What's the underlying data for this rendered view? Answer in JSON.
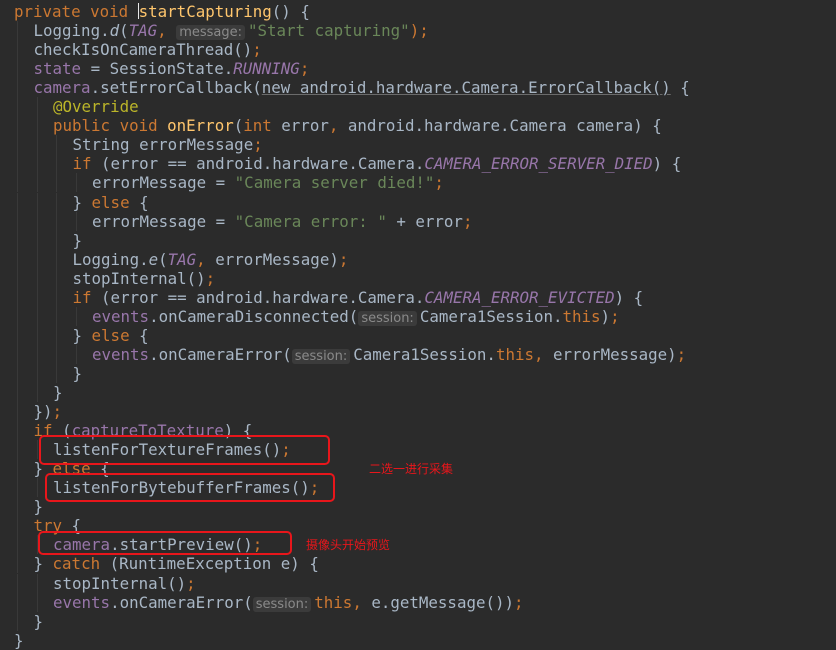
{
  "colors": {
    "background": "#2b2b2b",
    "keyword": "#cc7832",
    "plain": "#a9b7c6",
    "string": "#6a8759",
    "method_declaration": "#ffc66d",
    "field": "#9876aa",
    "annotation": "#bbb529",
    "annotation_box": "#e8161b",
    "annotation_text": "#e8161b"
  },
  "lines": [
    {
      "indent": 0,
      "tokens": [
        {
          "t": "private void ",
          "c": "kw"
        },
        {
          "t": "",
          "c": "caret"
        },
        {
          "t": "startCapturing",
          "c": "fn"
        },
        {
          "t": "() {",
          "c": "plain"
        }
      ]
    },
    {
      "indent": 1,
      "tokens": [
        {
          "t": "Logging.",
          "c": "plain"
        },
        {
          "t": "d",
          "c": "method-static"
        },
        {
          "t": "(",
          "c": "plain"
        },
        {
          "t": "TAG",
          "c": "static"
        },
        {
          "t": ", ",
          "c": "kw"
        },
        {
          "t": "message:",
          "c": "hint"
        },
        {
          "t": "\"Start capturing\"",
          "c": "str"
        },
        {
          "t": ");",
          "c": "kw"
        }
      ]
    },
    {
      "indent": 1,
      "tokens": [
        {
          "t": "checkIsOnCameraThread()",
          "c": "plain"
        },
        {
          "t": ";",
          "c": "kw"
        }
      ]
    },
    {
      "indent": 1,
      "tokens": [
        {
          "t": "state",
          "c": "field"
        },
        {
          "t": " = SessionState.",
          "c": "plain"
        },
        {
          "t": "RUNNING",
          "c": "static"
        },
        {
          "t": ";",
          "c": "kw"
        }
      ]
    },
    {
      "indent": 1,
      "tokens": [
        {
          "t": "camera",
          "c": "field"
        },
        {
          "t": ".setErrorCallback(",
          "c": "plain"
        },
        {
          "t": "new android.hardware.Camera.ErrorCallback()",
          "c": "anon"
        },
        {
          "t": " {",
          "c": "plain"
        }
      ]
    },
    {
      "indent": 2,
      "tokens": [
        {
          "t": "@Override",
          "c": "ann"
        }
      ]
    },
    {
      "indent": 2,
      "tokens": [
        {
          "t": "public void ",
          "c": "kw"
        },
        {
          "t": "onError",
          "c": "fn"
        },
        {
          "t": "(",
          "c": "plain"
        },
        {
          "t": "int ",
          "c": "kw"
        },
        {
          "t": "error",
          "c": "plain"
        },
        {
          "t": ", ",
          "c": "kw"
        },
        {
          "t": "android.hardware.Camera camera) {",
          "c": "plain"
        }
      ]
    },
    {
      "indent": 3,
      "tokens": [
        {
          "t": "String errorMessage",
          "c": "plain"
        },
        {
          "t": ";",
          "c": "kw"
        }
      ]
    },
    {
      "indent": 3,
      "tokens": [
        {
          "t": "if ",
          "c": "kw"
        },
        {
          "t": "(error == android.hardware.Camera.",
          "c": "plain"
        },
        {
          "t": "CAMERA_ERROR_SERVER_DIED",
          "c": "static"
        },
        {
          "t": ") {",
          "c": "plain"
        }
      ]
    },
    {
      "indent": 4,
      "tokens": [
        {
          "t": "errorMessage = ",
          "c": "plain"
        },
        {
          "t": "\"Camera server died!\"",
          "c": "str"
        },
        {
          "t": ";",
          "c": "kw"
        }
      ]
    },
    {
      "indent": 3,
      "tokens": [
        {
          "t": "} ",
          "c": "plain"
        },
        {
          "t": "else ",
          "c": "kw"
        },
        {
          "t": "{",
          "c": "plain"
        }
      ]
    },
    {
      "indent": 4,
      "tokens": [
        {
          "t": "errorMessage = ",
          "c": "plain"
        },
        {
          "t": "\"Camera error: \"",
          "c": "str"
        },
        {
          "t": " + error",
          "c": "plain"
        },
        {
          "t": ";",
          "c": "kw"
        }
      ]
    },
    {
      "indent": 3,
      "tokens": [
        {
          "t": "}",
          "c": "plain"
        }
      ]
    },
    {
      "indent": 3,
      "tokens": [
        {
          "t": "Logging.",
          "c": "plain"
        },
        {
          "t": "e",
          "c": "method-static"
        },
        {
          "t": "(",
          "c": "plain"
        },
        {
          "t": "TAG",
          "c": "static"
        },
        {
          "t": ", ",
          "c": "kw"
        },
        {
          "t": "errorMessage)",
          "c": "plain"
        },
        {
          "t": ";",
          "c": "kw"
        }
      ]
    },
    {
      "indent": 3,
      "tokens": [
        {
          "t": "stopInternal()",
          "c": "plain"
        },
        {
          "t": ";",
          "c": "kw"
        }
      ]
    },
    {
      "indent": 3,
      "tokens": [
        {
          "t": "if ",
          "c": "kw"
        },
        {
          "t": "(error == android.hardware.Camera.",
          "c": "plain"
        },
        {
          "t": "CAMERA_ERROR_EVICTED",
          "c": "static"
        },
        {
          "t": ") {",
          "c": "plain"
        }
      ]
    },
    {
      "indent": 4,
      "tokens": [
        {
          "t": "events",
          "c": "field"
        },
        {
          "t": ".onCameraDisconnected(",
          "c": "plain"
        },
        {
          "t": "session:",
          "c": "hint"
        },
        {
          "t": "Camera1Session.",
          "c": "plain"
        },
        {
          "t": "this",
          "c": "kw"
        },
        {
          "t": ")",
          "c": "plain"
        },
        {
          "t": ";",
          "c": "kw"
        }
      ]
    },
    {
      "indent": 3,
      "tokens": [
        {
          "t": "} ",
          "c": "plain"
        },
        {
          "t": "else ",
          "c": "kw"
        },
        {
          "t": "{",
          "c": "plain"
        }
      ]
    },
    {
      "indent": 4,
      "tokens": [
        {
          "t": "events",
          "c": "field"
        },
        {
          "t": ".onCameraError(",
          "c": "plain"
        },
        {
          "t": "session:",
          "c": "hint"
        },
        {
          "t": "Camera1Session.",
          "c": "plain"
        },
        {
          "t": "this",
          "c": "kw"
        },
        {
          "t": ", ",
          "c": "kw"
        },
        {
          "t": "errorMessage)",
          "c": "plain"
        },
        {
          "t": ";",
          "c": "kw"
        }
      ]
    },
    {
      "indent": 3,
      "tokens": [
        {
          "t": "}",
          "c": "plain"
        }
      ]
    },
    {
      "indent": 2,
      "tokens": [
        {
          "t": "}",
          "c": "plain"
        }
      ]
    },
    {
      "indent": 1,
      "tokens": [
        {
          "t": "})",
          "c": "plain"
        },
        {
          "t": ";",
          "c": "kw"
        }
      ]
    },
    {
      "indent": 1,
      "tokens": [
        {
          "t": "if ",
          "c": "kw"
        },
        {
          "t": "(",
          "c": "plain"
        },
        {
          "t": "captureToTexture",
          "c": "field"
        },
        {
          "t": ") {",
          "c": "plain"
        }
      ]
    },
    {
      "indent": 2,
      "tokens": [
        {
          "t": "listenForTextureFrames()",
          "c": "plain"
        },
        {
          "t": ";",
          "c": "kw"
        }
      ]
    },
    {
      "indent": 1,
      "tokens": [
        {
          "t": "} ",
          "c": "plain"
        },
        {
          "t": "else ",
          "c": "kw"
        },
        {
          "t": "{",
          "c": "plain"
        }
      ]
    },
    {
      "indent": 2,
      "tokens": [
        {
          "t": "listenForBytebufferFrames()",
          "c": "plain"
        },
        {
          "t": ";",
          "c": "kw"
        }
      ]
    },
    {
      "indent": 1,
      "tokens": [
        {
          "t": "}",
          "c": "plain"
        }
      ]
    },
    {
      "indent": 1,
      "tokens": [
        {
          "t": "try ",
          "c": "kw"
        },
        {
          "t": "{",
          "c": "plain"
        }
      ]
    },
    {
      "indent": 2,
      "tokens": [
        {
          "t": "camera",
          "c": "field"
        },
        {
          "t": ".startPreview()",
          "c": "plain"
        },
        {
          "t": ";",
          "c": "kw"
        }
      ]
    },
    {
      "indent": 1,
      "tokens": [
        {
          "t": "} ",
          "c": "plain"
        },
        {
          "t": "catch ",
          "c": "kw"
        },
        {
          "t": "(RuntimeException e) {",
          "c": "plain"
        }
      ]
    },
    {
      "indent": 2,
      "tokens": [
        {
          "t": "stopInternal()",
          "c": "plain"
        },
        {
          "t": ";",
          "c": "kw"
        }
      ]
    },
    {
      "indent": 2,
      "tokens": [
        {
          "t": "events",
          "c": "field"
        },
        {
          "t": ".onCameraError(",
          "c": "plain"
        },
        {
          "t": "session:",
          "c": "hint"
        },
        {
          "t": "this",
          "c": "kw"
        },
        {
          "t": ", ",
          "c": "kw"
        },
        {
          "t": "e.getMessage())",
          "c": "plain"
        },
        {
          "t": ";",
          "c": "kw"
        }
      ]
    },
    {
      "indent": 1,
      "tokens": [
        {
          "t": "}",
          "c": "plain"
        }
      ]
    },
    {
      "indent": 0,
      "tokens": [
        {
          "t": "}",
          "c": "plain"
        }
      ]
    }
  ],
  "annotations": [
    {
      "name": "choose-one-capture-note",
      "text": "二选一进行采集"
    },
    {
      "name": "camera-start-preview-note",
      "text": "摄像头开始预览"
    }
  ]
}
